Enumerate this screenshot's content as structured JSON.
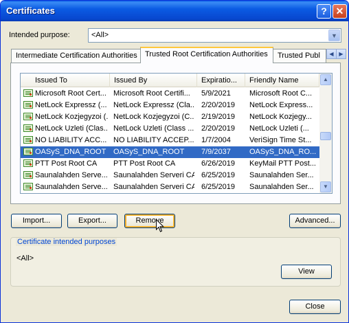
{
  "window": {
    "title": "Certificates"
  },
  "intended_purpose": {
    "label": "Intended purpose:",
    "value": "<All>"
  },
  "tabs": [
    {
      "label": "Intermediate Certification Authorities"
    },
    {
      "label": "Trusted Root Certification Authorities"
    },
    {
      "label": "Trusted Publ"
    }
  ],
  "columns": [
    "Issued To",
    "Issued By",
    "Expiratio...",
    "Friendly Name"
  ],
  "rows": [
    {
      "issued_to": "Microsoft Root Cert...",
      "issued_by": "Microsoft Root Certifi...",
      "expiration": "5/9/2021",
      "friendly_name": "Microsoft Root C..."
    },
    {
      "issued_to": "NetLock Expressz (...",
      "issued_by": "NetLock Expressz (Cla...",
      "expiration": "2/20/2019",
      "friendly_name": "NetLock Express..."
    },
    {
      "issued_to": "NetLock Kozjegyzoi (...",
      "issued_by": "NetLock Kozjegyzoi (C...",
      "expiration": "2/19/2019",
      "friendly_name": "NetLock Kozjegy..."
    },
    {
      "issued_to": "NetLock Uzleti (Clas...",
      "issued_by": "NetLock Uzleti (Class ...",
      "expiration": "2/20/2019",
      "friendly_name": "NetLock Uzleti (..."
    },
    {
      "issued_to": "NO LIABILITY ACC...",
      "issued_by": "NO LIABILITY ACCEP...",
      "expiration": "1/7/2004",
      "friendly_name": "VeriSign Time St..."
    },
    {
      "issued_to": "OASyS_DNA_ROOT",
      "issued_by": "OASyS_DNA_ROOT",
      "expiration": "7/9/2037",
      "friendly_name": "OASyS_DNA_RO...",
      "selected": true
    },
    {
      "issued_to": "PTT Post Root CA",
      "issued_by": "PTT Post Root CA",
      "expiration": "6/26/2019",
      "friendly_name": "KeyMail PTT Post..."
    },
    {
      "issued_to": "Saunalahden Serve...",
      "issued_by": "Saunalahden Serveri CA",
      "expiration": "6/25/2019",
      "friendly_name": "Saunalahden Ser..."
    },
    {
      "issued_to": "Saunalahden Serve...",
      "issued_by": "Saunalahden Serveri CA",
      "expiration": "6/25/2019",
      "friendly_name": "Saunalahden Ser..."
    }
  ],
  "buttons": {
    "import": "Import...",
    "export": "Export...",
    "remove": "Remove",
    "advanced": "Advanced...",
    "view": "View",
    "close": "Close"
  },
  "purposes": {
    "title": "Certificate intended purposes",
    "value": "<All>"
  },
  "icons": {
    "help": "?",
    "close": "✕",
    "dropdown": "▼",
    "tab_left": "◀",
    "tab_right": "▶",
    "scroll_up": "▲",
    "scroll_down": "▼"
  },
  "colors": {
    "titlebar": "#0a5ce6",
    "selection": "#316ac5",
    "group_title": "#0046d5",
    "dialog_bg": "#ece9d8"
  }
}
